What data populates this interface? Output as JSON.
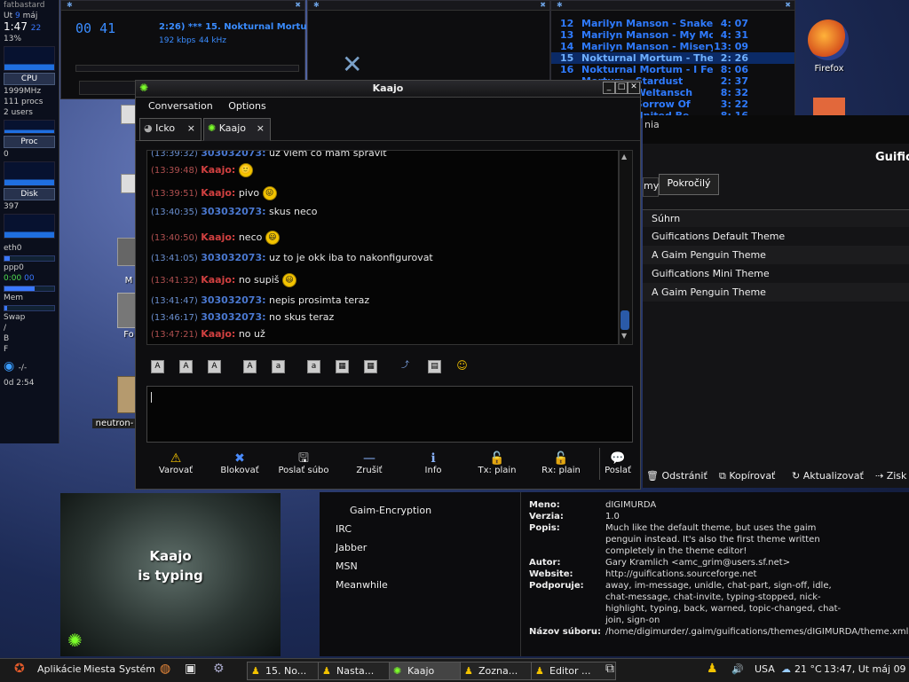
{
  "sysmon": {
    "host": "fatbastard",
    "day": "Ut",
    "date": "9",
    "month": "máj",
    "time": "1:47",
    "seconds": "22",
    "cpu_pct": "13%",
    "cpu_label": "CPU",
    "cpu_mhz": "1999MHz",
    "procs": "111 procs",
    "users": "2 users",
    "proc_label": "Proc",
    "proc_val": "0",
    "disk_label": "Disk",
    "disk_val": "397",
    "eth": "eth0",
    "ppp": "ppp0",
    "ppp_time": "0:00",
    "ppp_time2": "00",
    "mem": "Mem",
    "swap": "Swap",
    "fs1": "/",
    "fs2": "B",
    "fs3": "F",
    "uptime": "0d  2:54",
    "extra": "-/-"
  },
  "player": {
    "time": "00 41",
    "ticker": "2:26) *** 15. Nokturnal Mortum",
    "kbps": "192 kbps",
    "khz": "44 kHz"
  },
  "playlist": {
    "rows": [
      {
        "num": "12",
        "title": "Marilyn Manson - Snake Eyes and",
        "dur": "4: 07",
        "cur": false
      },
      {
        "num": "13",
        "title": "Marilyn Manson - My Monkey",
        "dur": "4: 31",
        "cur": false
      },
      {
        "num": "14",
        "title": "Marilyn Manson - Misery Machine",
        "dur": "13: 09",
        "cur": false
      },
      {
        "num": "15",
        "title": "Nokturnal Mortum - The Path Of",
        "dur": "2: 26",
        "cur": true
      },
      {
        "num": "16",
        "title": "Nokturnal Mortum - I Feel The B",
        "dur": "8: 06",
        "cur": false
      },
      {
        "num": "",
        "title": "Mortum - Stardust",
        "dur": "2: 37",
        "cur": false
      },
      {
        "num": "",
        "title": "Mortum - Weltansch",
        "dur": "8: 32",
        "cur": false
      },
      {
        "num": "",
        "title": "Mortum - Sorrow Of",
        "dur": "3: 22",
        "cur": false
      },
      {
        "num": "",
        "title": "Mortum - United Be",
        "dur": "8: 16",
        "cur": false
      }
    ]
  },
  "desktop": {
    "firefox": "Firefox",
    "neutron": "neutron-",
    "m_label": "M",
    "fo_label": "Fo"
  },
  "chat": {
    "title": "Kaajo",
    "menu": [
      "Conversation",
      "Options"
    ],
    "tabs": [
      {
        "label": "Icko",
        "close": "×"
      },
      {
        "label": "Kaajo",
        "close": "×"
      }
    ],
    "messages": [
      {
        "ts": "(13:39:48)",
        "nick": "Kaajo:",
        "text": "",
        "self": true,
        "smiley": "🙂"
      },
      {
        "ts": "(13:39:51)",
        "nick": "Kaajo:",
        "text": "pivo",
        "self": true,
        "smiley": "😛"
      },
      {
        "ts": "(13:40:35)",
        "nick": "303032073:",
        "text": "skus neco",
        "self": false,
        "smiley": ""
      },
      {
        "ts": "(13:40:50)",
        "nick": "Kaajo:",
        "text": "neco",
        "self": true,
        "smiley": "😃"
      },
      {
        "ts": "(13:41:05)",
        "nick": "303032073:",
        "text": "uz to je okk iba to nakonfigurovat",
        "self": false,
        "smiley": ""
      },
      {
        "ts": "(13:41:32)",
        "nick": "Kaajo:",
        "text": "no supiš",
        "self": true,
        "smiley": "😃"
      },
      {
        "ts": "(13:41:47)",
        "nick": "303032073:",
        "text": "nepis prosimta teraz",
        "self": false,
        "smiley": ""
      },
      {
        "ts": "(13:46:17)",
        "nick": "303032073:",
        "text": "no skus teraz",
        "self": false,
        "smiley": ""
      },
      {
        "ts": "(13:47:21)",
        "nick": "Kaajo:",
        "text": "no už",
        "self": true,
        "smiley": ""
      }
    ],
    "partial_top": {
      "ts": "(13:39:32)",
      "nick": "303032073:",
      "text": "uz viem co mam spravit"
    },
    "actions": [
      {
        "label": "Varovať",
        "icon": "⚠",
        "name": "warn-button"
      },
      {
        "label": "Blokovať",
        "icon": "✖",
        "name": "block-button"
      },
      {
        "label": "Poslať súbo",
        "icon": "🖫",
        "name": "send-file-button"
      },
      {
        "label": "Zrušiť",
        "icon": "—",
        "name": "cancel-button"
      },
      {
        "label": "Info",
        "icon": "ℹ",
        "name": "info-button"
      },
      {
        "label": "Tx: plain",
        "icon": "🔓",
        "name": "tx-plain-button"
      },
      {
        "label": "Rx: plain",
        "icon": "🔓",
        "name": "rx-plain-button"
      },
      {
        "label": "Poslať",
        "icon": "💬",
        "name": "send-button"
      }
    ]
  },
  "prefs": {
    "title_partial": "Guific",
    "header_partial": "nia",
    "tab_partial": "my",
    "tab_advanced": "Pokročilý",
    "col_header": "Súhrn",
    "themes": [
      "Guifications Default Theme",
      "A Gaim Penguin Theme",
      "Guifications Mini Theme",
      "A Gaim Penguin Theme"
    ],
    "buttons": [
      "Odstrániť",
      "Kopírovať",
      "Aktualizovať",
      "Zisk"
    ]
  },
  "plugins": {
    "items": [
      "Gaim-Encryption",
      "IRC",
      "Jabber",
      "MSN",
      "Meanwhile"
    ]
  },
  "details": {
    "rows": [
      {
        "k": "Meno:",
        "v": "dIGIMURDA"
      },
      {
        "k": "Verzia:",
        "v": "1.0"
      },
      {
        "k": "Popis:",
        "v": "Much like the default theme, but uses the gaim penguin instead.  It's also the first theme written completely in the theme editor!"
      },
      {
        "k": "Autor:",
        "v": "Gary Kramlich <amc_grim@users.sf.net>"
      },
      {
        "k": "Website:",
        "v": "http://guifications.sourceforge.net"
      },
      {
        "k": "Podporuje:",
        "v": "away, im-message, unidle, chat-part, sign-off, idle, chat-message, chat-invite, typing-stopped, nick-highlight, typing, back, warned, topic-changed, chat-join, sign-on"
      },
      {
        "k": "Názov súboru:",
        "v": "/home/digimurder/.gaim/guifications/themes/dIGIMURDA/theme.xml"
      }
    ]
  },
  "notify": {
    "line1": "Kaajo",
    "line2": "is typing"
  },
  "taskbar": {
    "menus": [
      "Aplikácie",
      "Miesta",
      "Systém"
    ],
    "tasks": [
      {
        "label": "15. No...",
        "active": false
      },
      {
        "label": "Nasta...",
        "active": false
      },
      {
        "label": "Kaajo",
        "active": true
      },
      {
        "label": "Zozna...",
        "active": false
      },
      {
        "label": "Editor ...",
        "active": false
      }
    ],
    "keyboard": "USA",
    "temp": "21 °C",
    "clock": "13:47, Ut máj 09"
  }
}
